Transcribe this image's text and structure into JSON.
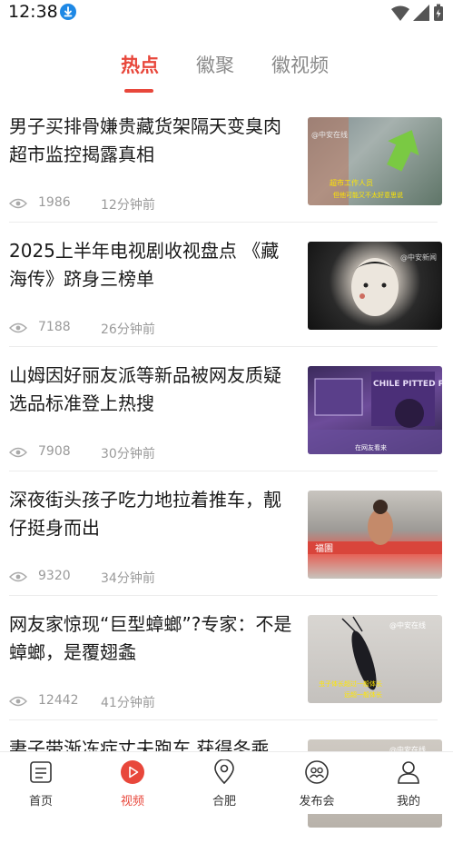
{
  "status_bar": {
    "time": "12:38"
  },
  "tabs": [
    {
      "label": "热点",
      "active": true
    },
    {
      "label": "徽聚",
      "active": false
    },
    {
      "label": "徽视频",
      "active": false
    }
  ],
  "feed": [
    {
      "title": "男子买排骨嫌贵藏货架隔天变臭肉 超市监控揭露真相",
      "views": "1986",
      "time": "12分钟前",
      "thumb_caption_1": "超市工作人员",
      "thumb_caption_2": "但他可能又不太好意思说",
      "thumb_watermark": "@中安在线"
    },
    {
      "title": "2025上半年电视剧收视盘点 《藏海传》跻身三榜单",
      "views": "7188",
      "time": "26分钟前",
      "thumb_watermark": "@中安新闻"
    },
    {
      "title": "山姆因好丽友派等新品被网友质疑选品标准登上热搜",
      "views": "7908",
      "time": "30分钟前",
      "thumb_text": "CHILE PITTED PRUNES",
      "thumb_caption_1": "在网友看来"
    },
    {
      "title": "深夜街头孩子吃力地拉着推车，靓仔挺身而出",
      "views": "9320",
      "time": "34分钟前",
      "thumb_text": "福園"
    },
    {
      "title": "网友家惊现“巨型蟑螂”?专家：不是蟑螂，是覆翅螽",
      "views": "12442",
      "time": "41分钟前",
      "thumb_caption_1": "虫子体长超过一般体长",
      "thumb_caption_2": "远超一般体长",
      "thumb_watermark": "@中安在线"
    },
    {
      "title": "妻子带渐冻症丈夫跑车 获得冬乘",
      "views": "",
      "time": "",
      "thumb_watermark": "@中安在线"
    }
  ],
  "bottom_nav": [
    {
      "label": "首页",
      "icon": "news-icon",
      "active": false
    },
    {
      "label": "视频",
      "icon": "play-icon",
      "active": true
    },
    {
      "label": "合肥",
      "icon": "location-pin-icon",
      "active": false
    },
    {
      "label": "发布会",
      "icon": "chat-group-icon",
      "active": false
    },
    {
      "label": "我的",
      "icon": "person-icon",
      "active": false
    }
  ],
  "colors": {
    "accent": "#e8473b",
    "meta": "#9a9a9a",
    "download_badge": "#1e88e5"
  }
}
